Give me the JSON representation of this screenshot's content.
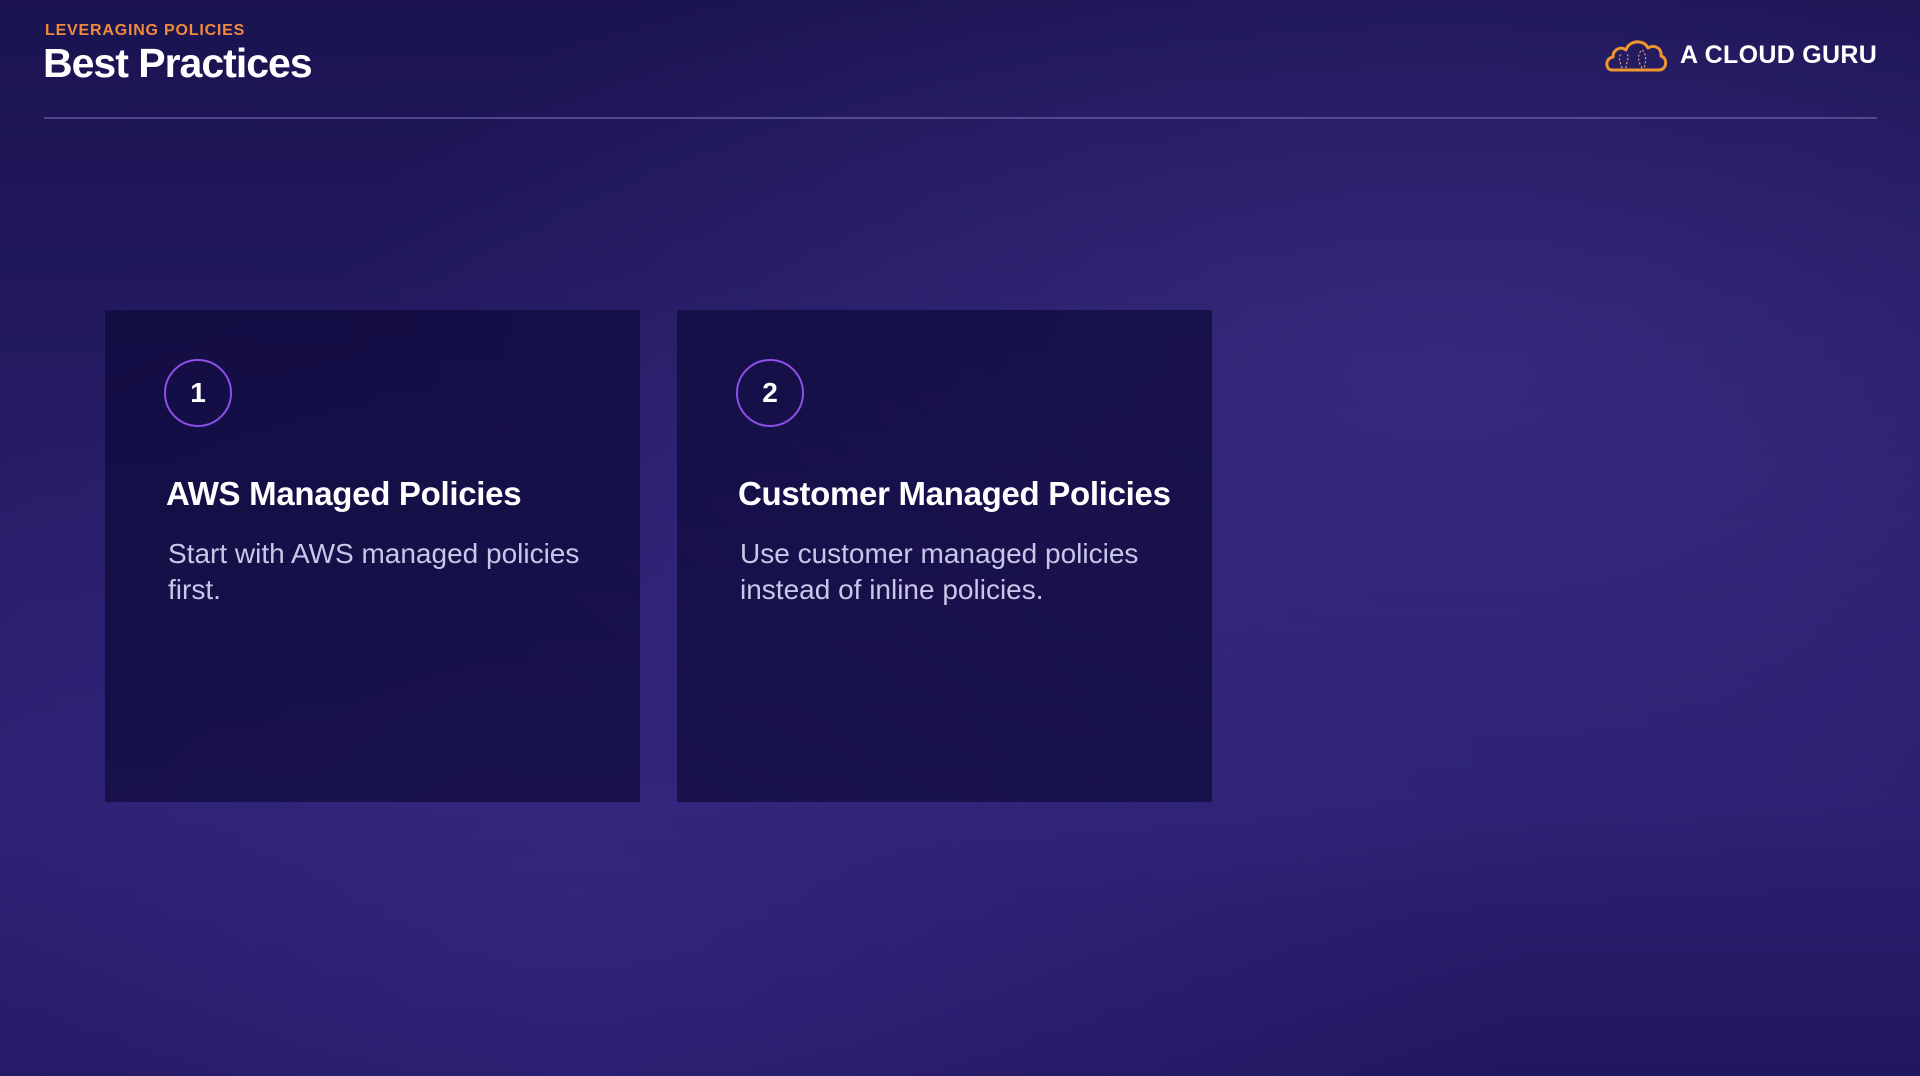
{
  "header": {
    "eyebrow": "LEVERAGING POLICIES",
    "title": "Best Practices"
  },
  "logo": {
    "text": "A CLOUD GURU",
    "icon": "cloud-logo-icon",
    "accent": "#f0962f"
  },
  "cards": [
    {
      "number": "1",
      "heading": "AWS Managed Policies",
      "body": "Start with AWS managed policies first."
    },
    {
      "number": "2",
      "heading": "Customer Managed Policies",
      "body": "Use customer managed policies instead of inline policies."
    }
  ],
  "colors": {
    "eyebrow": "#f08a3c",
    "circle": "#8f4ee8"
  }
}
